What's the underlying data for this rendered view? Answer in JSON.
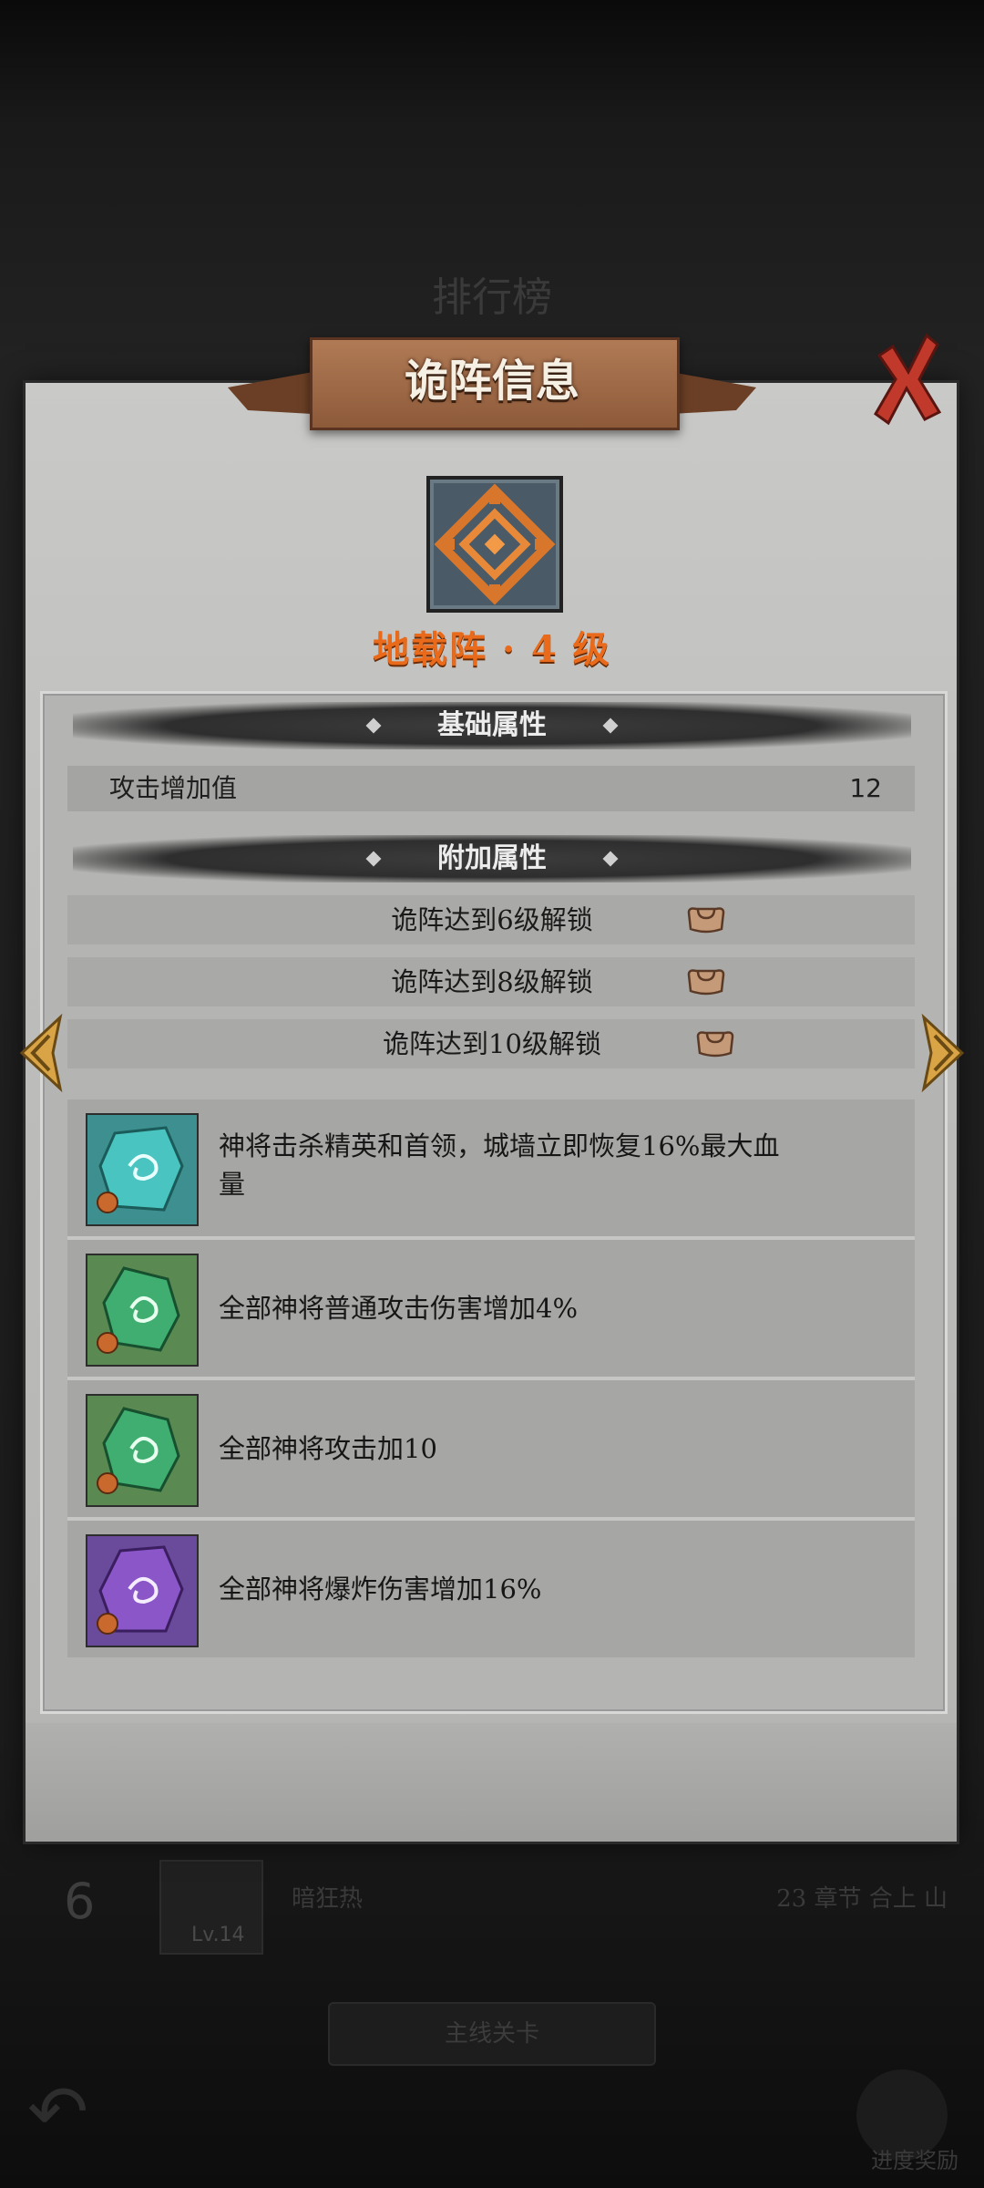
{
  "background": {
    "screen_title": "排行榜",
    "rank_number": "6",
    "player_level": "Lv.14",
    "player_name": "暗狂热",
    "progress_text": "23 章节 合上 山",
    "main_button_label": "主线关卡",
    "progress_label": "进度奖励"
  },
  "dialog": {
    "title": "诡阵信息",
    "formation_name": "地载阵 · 4 级",
    "basic_section_title": "基础属性",
    "basic_attributes": [
      {
        "label": "攻击增加值",
        "value": "12"
      }
    ],
    "extra_section_title": "附加属性",
    "locked_attributes": [
      {
        "text": "诡阵达到6级解锁"
      },
      {
        "text": "诡阵达到8级解锁"
      },
      {
        "text": "诡阵达到10级解锁"
      }
    ],
    "effects": [
      {
        "gem": "teal-gem-icon",
        "color": "#3aa6a0",
        "text": "神将击杀精英和首领，城墙立即恢复16%最大血量"
      },
      {
        "gem": "green-gem-icon",
        "color": "#3c9a62",
        "text": "全部神将普通攻击伤害增加4%"
      },
      {
        "gem": "green-gem-icon",
        "color": "#3c9a62",
        "text": "全部神将攻击加10"
      },
      {
        "gem": "purple-gem-icon",
        "color": "#7b4bb0",
        "text": "全部神将爆炸伤害增加16%"
      }
    ]
  },
  "colors": {
    "accent_orange": "#e86a1a",
    "banner_brown": "#8d5a3a",
    "close_red": "#c0392b",
    "arrow_gold": "#d9a446"
  }
}
